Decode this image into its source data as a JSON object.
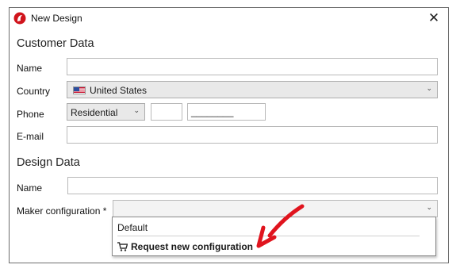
{
  "window": {
    "title": "New Design",
    "close_symbol": "✕"
  },
  "customer": {
    "heading": "Customer Data",
    "name_label": "Name",
    "name_value": "",
    "country_label": "Country",
    "country_value": "United States",
    "phone_label": "Phone",
    "phone_type": "Residential",
    "phone_area": "",
    "phone_number_mask": "________",
    "email_label": "E-mail",
    "email_value": ""
  },
  "design": {
    "heading": "Design Data",
    "name_label": "Name",
    "name_value": "",
    "maker_label": "Maker configuration *",
    "maker_value": ""
  },
  "dropdown": {
    "options": [
      "Default"
    ],
    "action_label": "Request new configuration"
  },
  "icons": [
    "app-logo-icon",
    "close-icon",
    "us-flag-icon",
    "chevron-down-icon",
    "cart-icon",
    "red-arrow-annotation"
  ],
  "colors": {
    "accent_red": "#e0141e",
    "combo_bg": "#e9e9e9"
  }
}
